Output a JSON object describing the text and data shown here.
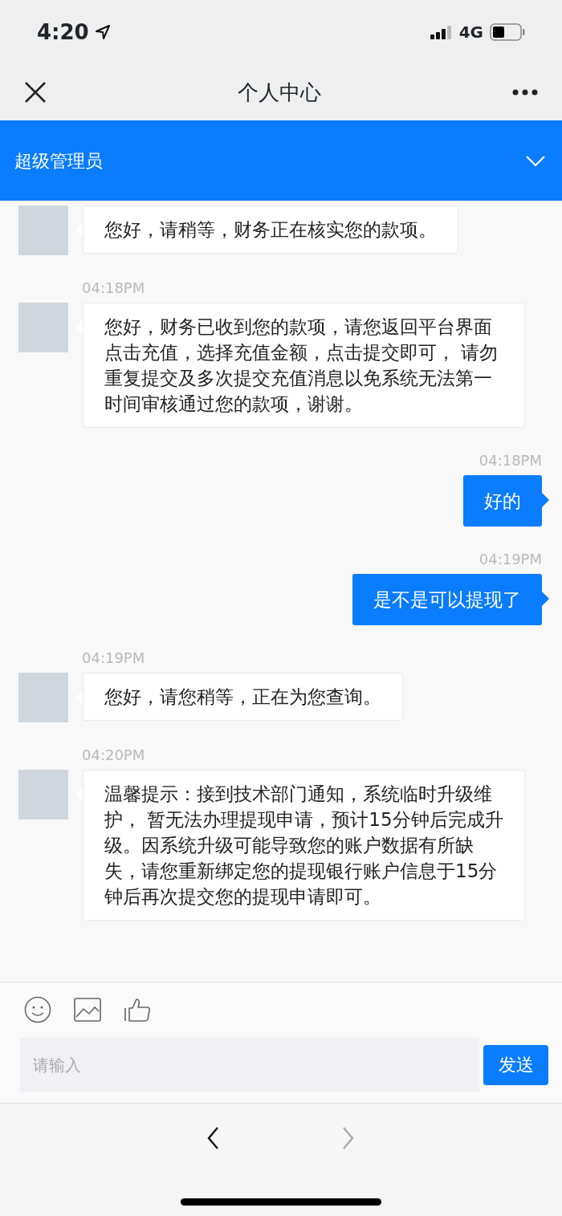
{
  "status_bar": {
    "time": "4:20",
    "network": "4G"
  },
  "nav_bar": {
    "title": "个人中心"
  },
  "agent_bar": {
    "title": "超级管理员",
    "expanded": false
  },
  "messages": [
    {
      "kind": "agent",
      "text": "您好，请稍等，财务正在核实您的款项。"
    },
    {
      "kind": "agent",
      "time": "04:18PM",
      "text": "您好，财务已收到您的款项，请您返回平台界面点击充值，选择充值金额，点击提交即可， 请勿重复提交及多次提交充值消息以免系统无法第一时间审核通过您的款项，谢谢。"
    },
    {
      "kind": "user",
      "time": "04:18PM",
      "text": "好的"
    },
    {
      "kind": "user",
      "time": "04:19PM",
      "text": "是不是可以提现了"
    },
    {
      "kind": "agent",
      "time": "04:19PM",
      "text": "您好，请您稍等，正在为您查询。"
    },
    {
      "kind": "agent",
      "time": "04:20PM",
      "text": "温馨提示：接到技术部门通知，系统临时升级维护， 暂无法办理提现申请，预计15分钟后完成升级。因系统升级可能导致您的账户数据有所缺失，请您重新绑定您的提现银行账户信息于15分钟后再次提交您的提现申请即可。"
    }
  ],
  "composer": {
    "placeholder": "请输入",
    "send_label": "发送"
  },
  "browser_nav": {
    "back_disabled": false,
    "forward_disabled": true
  }
}
